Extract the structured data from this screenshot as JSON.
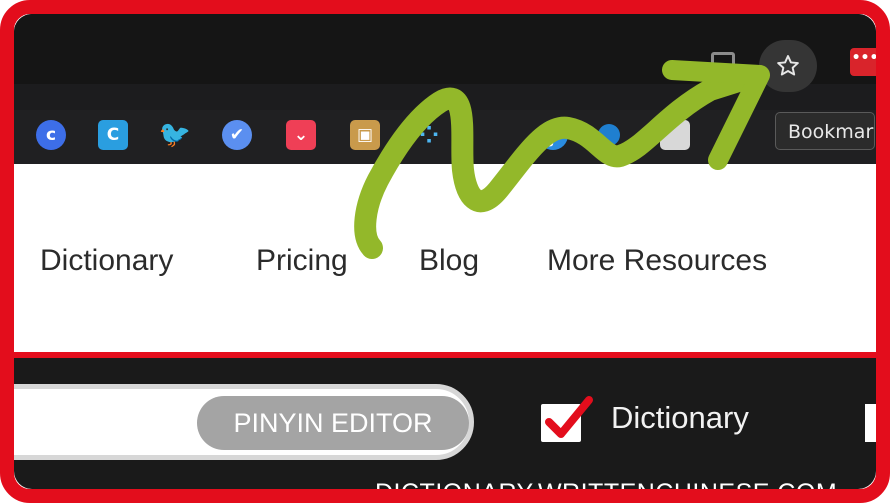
{
  "colors": {
    "frame": "#e30d1c",
    "arrow": "#93b82a",
    "pinyin_button": "#a4a4a4",
    "checkbox_mark": "#e30d1c"
  },
  "browser": {
    "bookmark_star_icon": "star-icon",
    "tooltip": "Bookmark"
  },
  "bookmarks": [
    {
      "icon": "c-circle-icon",
      "glyph": "c"
    },
    {
      "icon": "c-square-icon",
      "glyph": "C"
    },
    {
      "icon": "twitter-bird-icon",
      "glyph": "🐦"
    },
    {
      "icon": "check-circle-icon",
      "glyph": "✔"
    },
    {
      "icon": "pocket-icon",
      "glyph": "⌄"
    },
    {
      "icon": "box-icon",
      "glyph": "▣"
    },
    {
      "icon": "dots-icon",
      "glyph": "⁘"
    },
    {
      "icon": "s-circle-icon",
      "glyph": "ꝭ"
    },
    {
      "icon": "blue-dot-icon",
      "glyph": ""
    },
    {
      "icon": "doc-icon",
      "glyph": ""
    },
    {
      "icon": "red-circle-icon",
      "glyph": ""
    }
  ],
  "nav": {
    "items": [
      "Dictionary",
      "Pricing",
      "Blog",
      "More Resources"
    ]
  },
  "search": {
    "pinyin_button": "PINYIN EDITOR",
    "checkbox_label": "Dictionary",
    "checkbox_checked": true
  },
  "footer": {
    "url": "DICTIONARY.WRITTENCHINESE.COM"
  }
}
